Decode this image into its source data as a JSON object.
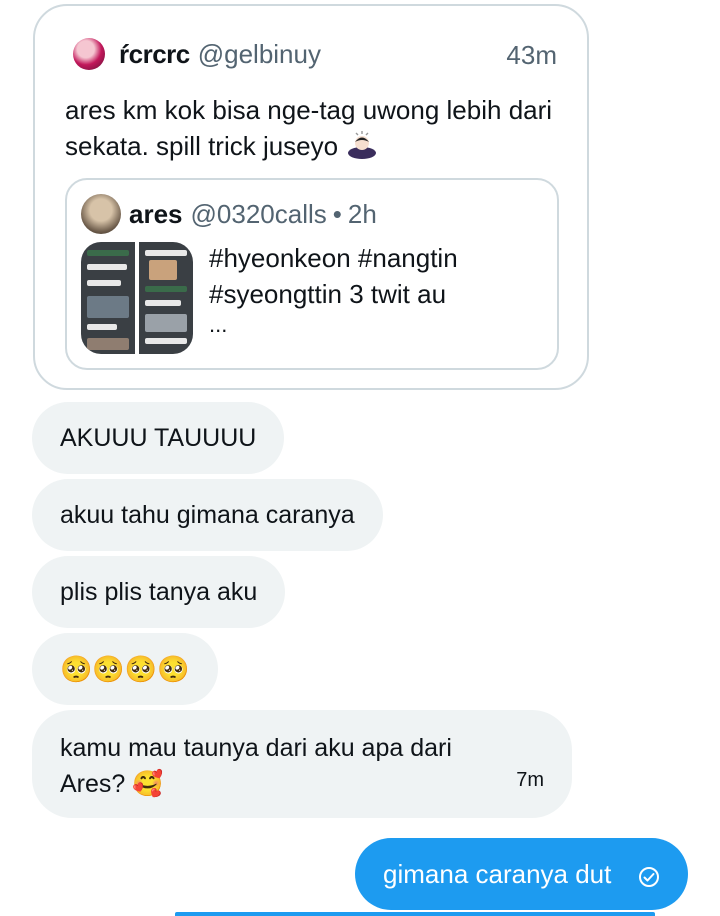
{
  "quoted_tweet": {
    "display_name": "ŕcrcrc",
    "handle": "@gelbinuy",
    "time": "43m",
    "text": "ares km kok bisa nge-tag uwong lebih dari sekata. spill trick juseyo",
    "emoji": "🙇🏻‍♀️",
    "inner_tweet": {
      "display_name": "ares",
      "handle": "@0320calls",
      "separator": "•",
      "time": "2h",
      "text_line1": "#hyeonkeon #nangtin",
      "text_line2": "#syeongttin 3 twit au",
      "text_line3": "..."
    }
  },
  "messages": [
    {
      "text": "AKUUU TAUUUU"
    },
    {
      "text": "akuu tahu gimana caranya"
    },
    {
      "text": "plis plis tanya aku"
    },
    {
      "text": "🥺🥺🥺🥺"
    },
    {
      "text": "kamu mau taunya dari aku apa dari Ares? 🥰",
      "time": "7m"
    }
  ],
  "sent_message": {
    "text": "gimana caranya dut",
    "status_icon": "sent-check-icon"
  },
  "colors": {
    "accent": "#1d9bf0",
    "bubble_bg": "#eff3f4",
    "muted_text": "#536471",
    "border": "#cfd9de"
  }
}
